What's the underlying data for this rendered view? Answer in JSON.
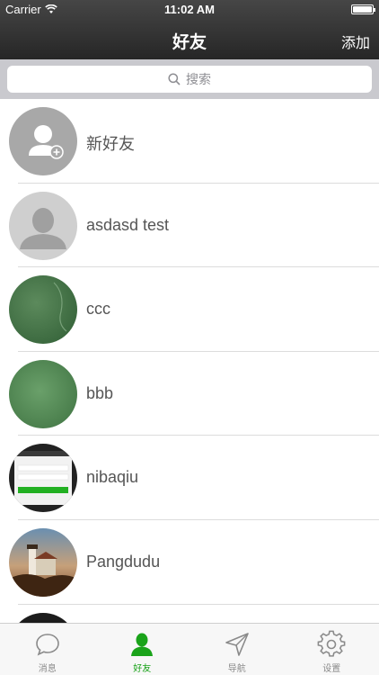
{
  "status_bar": {
    "carrier": "Carrier",
    "time": "11:02 AM"
  },
  "nav": {
    "title": "好友",
    "add_label": "添加"
  },
  "search": {
    "placeholder": "搜索"
  },
  "contacts": [
    {
      "name": "新好友",
      "avatar": "new-friend-icon"
    },
    {
      "name": "asdasd test",
      "avatar": "default-user-icon"
    },
    {
      "name": "ccc",
      "avatar": "photo"
    },
    {
      "name": "bbb",
      "avatar": "photo"
    },
    {
      "name": "nibaqiu",
      "avatar": "app-screenshot-thumbnail"
    },
    {
      "name": "Pangdudu",
      "avatar": "lighthouse-photo"
    }
  ],
  "tabs": [
    {
      "label": "消息",
      "icon": "chat-bubble-icon",
      "active": false
    },
    {
      "label": "好友",
      "icon": "person-icon",
      "active": true
    },
    {
      "label": "导航",
      "icon": "navigation-arrow-icon",
      "active": false
    },
    {
      "label": "设置",
      "icon": "gear-icon",
      "active": false
    }
  ],
  "colors": {
    "nav_bg": "#2f2f2f",
    "active_tab": "#1aa31a",
    "inactive_tab": "#8a8a8a"
  }
}
